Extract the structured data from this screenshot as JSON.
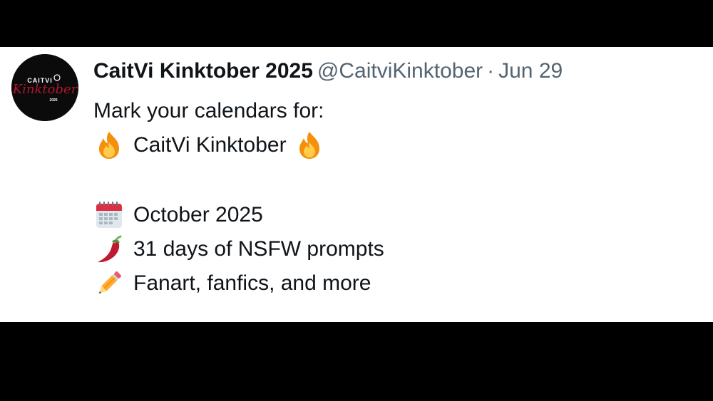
{
  "post": {
    "avatar_text": {
      "line1": "CAITVI",
      "line2": "Kinktober",
      "line3": "2025"
    },
    "display_name": "CaitVi Kinktober 2025",
    "handle": "@CaitviKinktober",
    "separator": "·",
    "date": "Jun 29",
    "lines": {
      "intro": "Mark your calendars for:",
      "event_name": "CaitVi Kinktober",
      "date_line": "October 2025",
      "prompts_line": "31 days of NSFW prompts",
      "content_line": "Fanart, fanfics, and more"
    },
    "icons": {
      "fire": "fire-icon",
      "calendar": "calendar-icon",
      "pepper": "hot-pepper-icon",
      "pencil": "pencil-icon"
    }
  },
  "colors": {
    "background": "#000000",
    "card": "#ffffff",
    "text_primary": "#0f1419",
    "text_secondary": "#536471",
    "avatar_bg": "#0b0b0b",
    "avatar_script": "#b0152c"
  }
}
